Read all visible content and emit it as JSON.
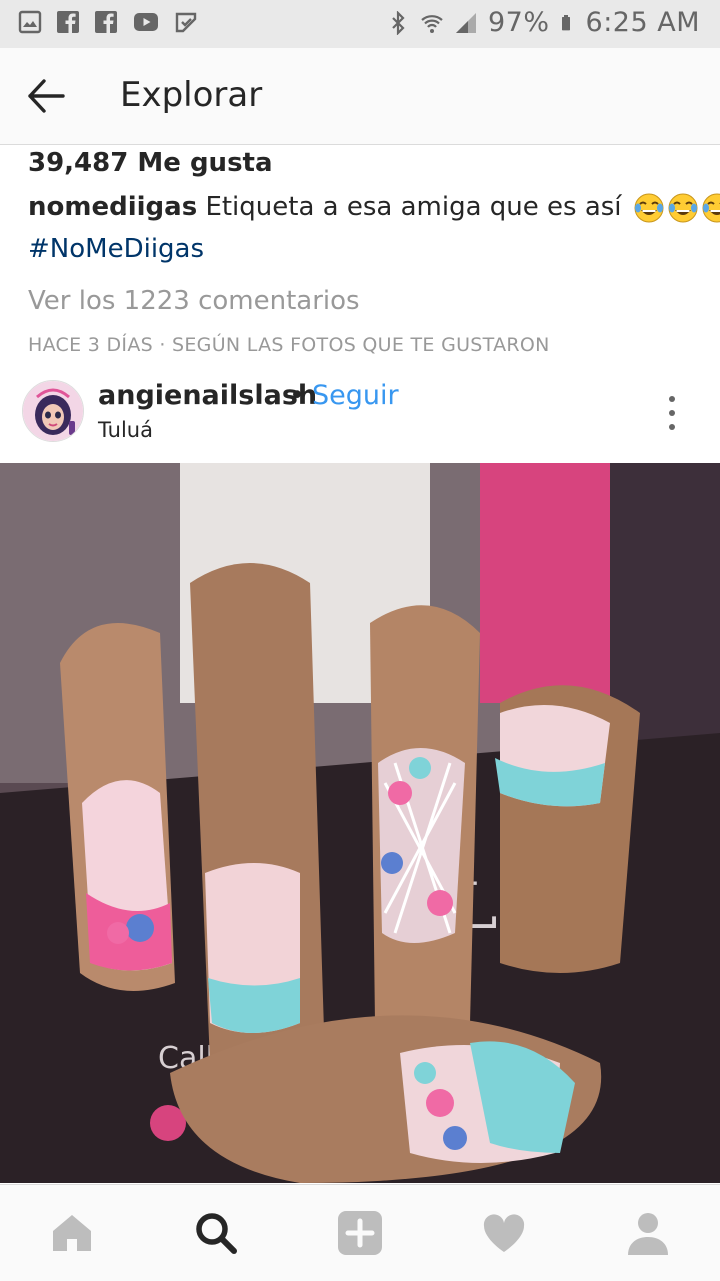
{
  "status_bar": {
    "battery": "97%",
    "time": "6:25 AM",
    "left_icons": [
      "gallery-icon",
      "facebook-icon",
      "facebook-icon",
      "youtube-icon",
      "download-done-icon"
    ],
    "right_icons": [
      "bluetooth-icon",
      "wifi-icon",
      "signal-icon",
      "battery-icon"
    ]
  },
  "app_bar": {
    "title": "Explorar",
    "back_icon": "arrow-left-icon"
  },
  "post": {
    "likes": "39,487 Me gusta",
    "caption_user": "nomediigas",
    "caption_text": "Etiqueta a esa amiga que es así",
    "caption_emojis": [
      "face-with-tears-of-joy-icon",
      "face-with-tears-of-joy-icon",
      "face-with-tears-of-joy-icon"
    ],
    "hashtag": "#NoMeDiigas",
    "comments_link": "Ver los 1223 comentarios",
    "time_ago": "HACE 3 DÍAS · SEGÚN LAS FOTOS QUE TE GUSTARON"
  },
  "next_post": {
    "username": "angienailslash",
    "separator": "•",
    "follow_label": "Seguir",
    "location": "Tuluá",
    "photo_card_text": "Lash",
    "photo_card_address": "Calle 26 N"
  },
  "bottom_nav": {
    "items": [
      "home-icon",
      "search-icon",
      "add-post-icon",
      "heart-icon",
      "profile-icon"
    ],
    "active": "search-icon"
  },
  "colors": {
    "link": "#3897f0",
    "hashtag": "#003569",
    "muted": "#999999"
  }
}
